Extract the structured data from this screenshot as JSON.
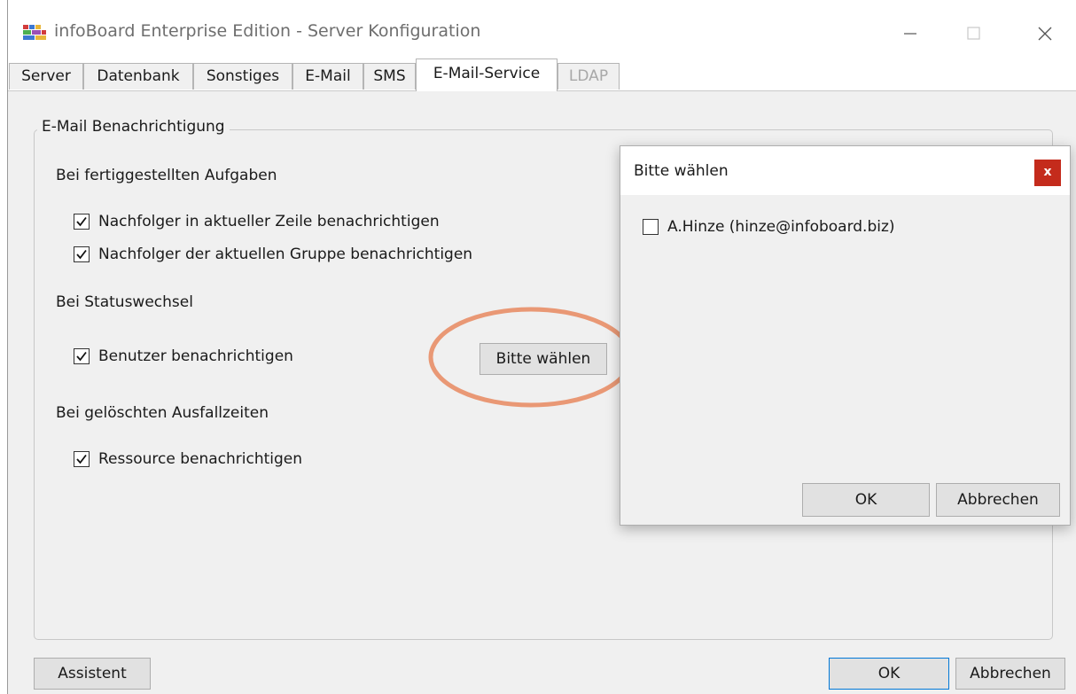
{
  "window": {
    "title": "infoBoard Enterprise Edition - Server Konfiguration"
  },
  "tabs": [
    {
      "label": "Server",
      "state": "normal"
    },
    {
      "label": "Datenbank",
      "state": "normal"
    },
    {
      "label": "Sonstiges",
      "state": "normal"
    },
    {
      "label": "E-Mail",
      "state": "normal"
    },
    {
      "label": "SMS",
      "state": "normal"
    },
    {
      "label": "E-Mail-Service",
      "state": "active"
    },
    {
      "label": "LDAP",
      "state": "disabled"
    }
  ],
  "group": {
    "legend": "E-Mail Benachrichtigung",
    "completed_tasks": {
      "heading": "Bei fertiggestellten Aufgaben",
      "options": [
        {
          "label": "Nachfolger in aktueller Zeile benachrichtigen",
          "checked": true
        },
        {
          "label": "Nachfolger der aktuellen Gruppe benachrichtigen",
          "checked": true
        }
      ]
    },
    "status_change": {
      "heading": "Bei Statuswechsel",
      "option": {
        "label": "Benutzer benachrichtigen",
        "checked": true
      },
      "choose_button": "Bitte wählen"
    },
    "deleted_downtimes": {
      "heading": "Bei gelöschten Ausfallzeiten",
      "option": {
        "label": "Ressource benachrichtigen",
        "checked": true
      }
    }
  },
  "footer": {
    "wizard_button": "Assistent",
    "ok_button": "OK",
    "cancel_button": "Abbrechen"
  },
  "dialog": {
    "title": "Bitte wählen",
    "close_glyph": "x",
    "items": [
      {
        "label": "A.Hinze (hinze@infoboard.biz)",
        "checked": false
      }
    ],
    "ok_button": "OK",
    "cancel_button": "Abbrechen"
  },
  "colors": {
    "annotation_ellipse": "#e8906a",
    "close_button": "#c42b1c",
    "window_background": "#f0f0f0",
    "default_button_border": "#0078d7"
  },
  "icons": [
    "app-icon",
    "minimize-icon",
    "maximize-icon",
    "close-icon",
    "checkmark-icon"
  ]
}
